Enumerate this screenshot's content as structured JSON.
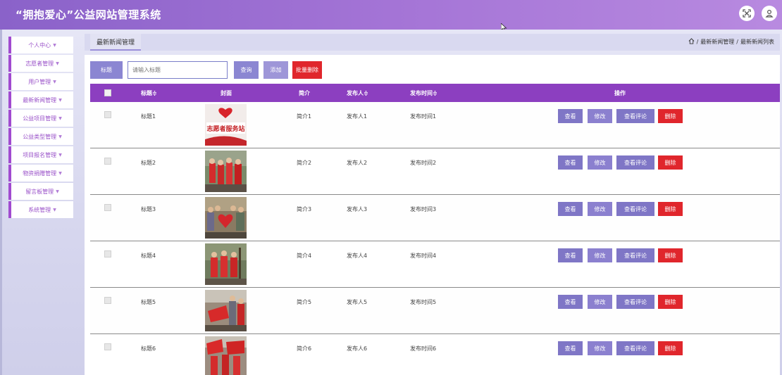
{
  "header": {
    "title": "“拥抱爱心”公益网站管理系统",
    "icons": [
      "fullscreen-icon",
      "user-icon"
    ]
  },
  "sidebar": {
    "items": [
      {
        "label": "个人中心"
      },
      {
        "label": "志愿者管理"
      },
      {
        "label": "用户管理"
      },
      {
        "label": "最新新闻管理"
      },
      {
        "label": "公益项目管理"
      },
      {
        "label": "公益类型管理"
      },
      {
        "label": "项目报名管理"
      },
      {
        "label": "物资捐赠管理"
      },
      {
        "label": "留言板管理"
      },
      {
        "label": "系统管理"
      }
    ]
  },
  "breadcrumb": {
    "tab": "最新新闻管理",
    "path": [
      "最新新闻管理",
      "最新新闻列表"
    ],
    "separator": "/"
  },
  "search": {
    "label": "标题",
    "placeholder": "请输入标题",
    "query_button": "查询",
    "add_button": "添加",
    "batch_delete_button": "批量删除"
  },
  "table": {
    "columns": {
      "title": "标题≑",
      "cover": "封面",
      "summary": "简介",
      "publisher": "发布人≑",
      "time": "发布时间≑",
      "actions": "操作"
    },
    "actions": {
      "view": "查看",
      "edit": "修改",
      "comments": "查看评论",
      "delete": "删除"
    },
    "rows": [
      {
        "title": "标题1",
        "summary": "简介1",
        "publisher": "发布人1",
        "time": "发布时间1",
        "cover_text": "志愿者服务站"
      },
      {
        "title": "标题2",
        "summary": "简介2",
        "publisher": "发布人2",
        "time": "发布时间2",
        "cover_text": ""
      },
      {
        "title": "标题3",
        "summary": "简介3",
        "publisher": "发布人3",
        "time": "发布时间3",
        "cover_text": ""
      },
      {
        "title": "标题4",
        "summary": "简介4",
        "publisher": "发布人4",
        "time": "发布时间4",
        "cover_text": ""
      },
      {
        "title": "标题5",
        "summary": "简介5",
        "publisher": "发布人5",
        "time": "发布时间5",
        "cover_text": ""
      },
      {
        "title": "标题6",
        "summary": "简介6",
        "publisher": "发布人6",
        "time": "发布时间6",
        "cover_text": ""
      }
    ]
  },
  "colors": {
    "header_gradient_start": "#8a62c9",
    "header_gradient_end": "#b88ae0",
    "accent_purple": "#8c3fc0",
    "button_blue": "#8b86d2",
    "danger_red": "#e0262c"
  }
}
